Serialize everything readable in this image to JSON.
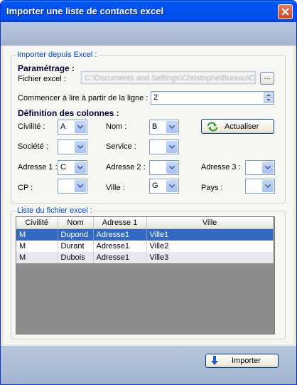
{
  "window": {
    "title": "Importer une liste de contacts excel"
  },
  "import_group": {
    "legend": "Importer depuis Excel :",
    "parametrage_title": "Paramétrage :",
    "fichier_label": "Fichier excel :",
    "fichier_value": "C:\\Documents and Settings\\Christophe\\Bureau\\C",
    "browse_label": "...",
    "start_line_label": "Commencer à lire à partir de la ligne :",
    "start_line_value": "2",
    "columns_title": "Définition des colonnes :",
    "refresh_label": "Actualiser"
  },
  "fields": {
    "civilite": {
      "label": "Civilité :",
      "value": "A"
    },
    "nom": {
      "label": "Nom :",
      "value": "B"
    },
    "societe": {
      "label": "Société :",
      "value": ""
    },
    "service": {
      "label": "Service :",
      "value": ""
    },
    "adresse1": {
      "label": "Adresse 1 :",
      "value": "C"
    },
    "adresse2": {
      "label": "Adresse 2 :",
      "value": ""
    },
    "adresse3": {
      "label": "Adresse 3 :",
      "value": ""
    },
    "cp": {
      "label": "CP :",
      "value": ""
    },
    "ville": {
      "label": "Ville :",
      "value": "G"
    },
    "pays": {
      "label": "Pays :",
      "value": ""
    }
  },
  "list_group": {
    "legend": "Liste du fichier excel :",
    "columns": [
      "Civilité",
      "Nom",
      "Adresse 1",
      "Ville"
    ],
    "rows": [
      [
        "M",
        "Dupond",
        "Adresse1",
        "Ville1"
      ],
      [
        "M",
        "Durant",
        "Adresse1",
        "Ville2"
      ],
      [
        "M",
        "Dubois",
        "Adresse1",
        "Ville3"
      ]
    ]
  },
  "footer": {
    "import_label": "Importer"
  },
  "colors": {
    "title_blue": "#0053ee",
    "selection": "#316ac5",
    "legend_blue": "#0046d5"
  }
}
